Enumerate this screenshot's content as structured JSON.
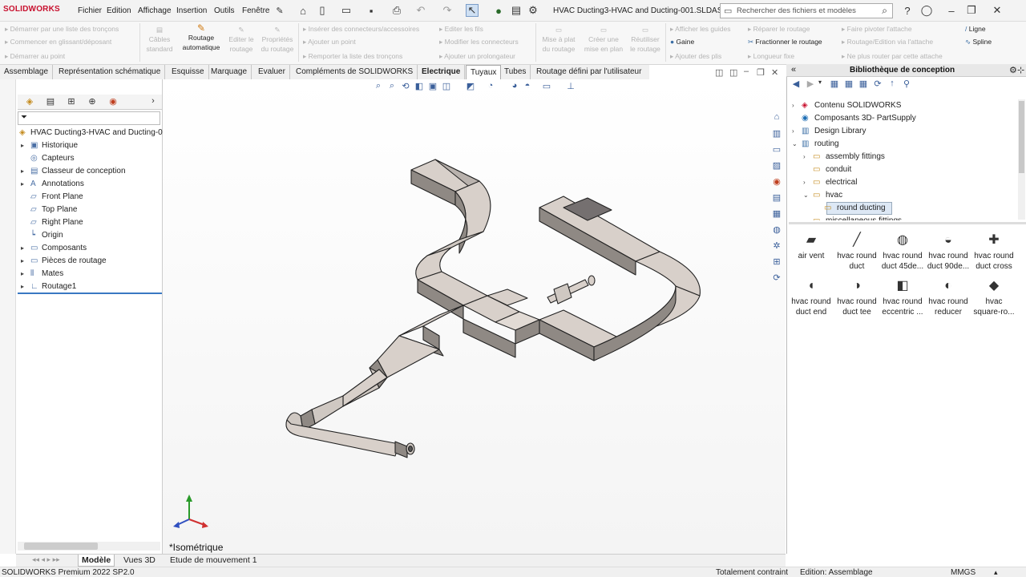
{
  "app": {
    "logo": "SOLIDWORKS",
    "document_title": "HVAC Ducting3-HVAC and Ducting-001.SLDAS...",
    "search_placeholder": "Rechercher des fichiers et modèles"
  },
  "menu": [
    "Fichier",
    "Edition",
    "Affichage",
    "Insertion",
    "Outils",
    "Fenêtre"
  ],
  "ribbon": {
    "col1": [
      "Démarrer par une liste des tronçons",
      "Commencer en glissant/déposant",
      "Démarrer au point"
    ],
    "btn_cables": [
      "Câbles",
      "standard"
    ],
    "btn_routage_auto": [
      "Routage",
      "automatique"
    ],
    "btn_editer_routage": [
      "Editer le",
      "routage"
    ],
    "btn_proprietes": [
      "Propriétés",
      "du routage"
    ],
    "col2": [
      "Insérer des connecteurs/accessoires",
      "Ajouter un point",
      "Remporter la liste des tronçons"
    ],
    "col3": [
      "Editer les fils",
      "Modifier les connecteurs",
      "Ajouter un prolongateur"
    ],
    "btn_mise_plat": [
      "Mise à plat",
      "du routage"
    ],
    "btn_creer_mise": [
      "Créer une",
      "mise en plan"
    ],
    "btn_reutiliser": [
      "Réutiliser",
      "le routage"
    ],
    "col4": [
      "Afficher les guides",
      "Gaine",
      "Ajouter des plis"
    ],
    "col5": [
      "Réparer le routage",
      "Fractionner le routage",
      "Longueur fixe"
    ],
    "col6": [
      "Faire pivoter l'attache",
      "Routage/Edition via l'attache",
      "Ne plus router par cette attache"
    ],
    "col7": [
      "Ligne",
      "Spline"
    ]
  },
  "tabs": [
    "Assemblage",
    "Représentation schématique",
    "Esquisse",
    "Marquage",
    "Evaluer",
    "Compléments de SOLIDWORKS",
    "Electrique",
    "Tuyaux",
    "Tubes",
    "Routage défini par l'utilisateur"
  ],
  "feature_tree": [
    {
      "label": "HVAC Ducting3-HVAC and Ducting-0",
      "arrow": "",
      "icon": "assembly-icon"
    },
    {
      "label": "Historique",
      "arrow": "▸",
      "icon": "history-icon"
    },
    {
      "label": "Capteurs",
      "arrow": "",
      "icon": "sensor-icon"
    },
    {
      "label": "Classeur de conception",
      "arrow": "▸",
      "icon": "binder-icon"
    },
    {
      "label": "Annotations",
      "arrow": "▸",
      "icon": "annotation-icon"
    },
    {
      "label": "Front Plane",
      "arrow": "",
      "icon": "plane-icon"
    },
    {
      "label": "Top Plane",
      "arrow": "",
      "icon": "plane-icon"
    },
    {
      "label": "Right Plane",
      "arrow": "",
      "icon": "plane-icon"
    },
    {
      "label": "Origin",
      "arrow": "",
      "icon": "origin-icon"
    },
    {
      "label": "Composants",
      "arrow": "▸",
      "icon": "folder-icon"
    },
    {
      "label": "Pièces de routage",
      "arrow": "▸",
      "icon": "folder-icon"
    },
    {
      "label": "Mates",
      "arrow": "▸",
      "icon": "mates-icon"
    },
    {
      "label": "Routage1",
      "arrow": "▸",
      "icon": "route-icon"
    }
  ],
  "viewport": {
    "view_label": "*Isométrique"
  },
  "design_library": {
    "title": "Bibliothèque de conception",
    "tree": [
      {
        "label": "Contenu SOLIDWORKS",
        "arrow": "›",
        "indent": 0
      },
      {
        "label": "Composants 3D- PartSupply",
        "arrow": "",
        "indent": 0
      },
      {
        "label": "Design Library",
        "arrow": "›",
        "indent": 0
      },
      {
        "label": "routing",
        "arrow": "⌄",
        "indent": 0
      },
      {
        "label": "assembly fittings",
        "arrow": "›",
        "indent": 1
      },
      {
        "label": "conduit",
        "arrow": "",
        "indent": 1
      },
      {
        "label": "electrical",
        "arrow": "›",
        "indent": 1
      },
      {
        "label": "hvac",
        "arrow": "⌄",
        "indent": 1
      },
      {
        "label": "round ducting",
        "arrow": "",
        "indent": 2
      },
      {
        "label": "miscellaneous fittings",
        "arrow": "",
        "indent": 1
      }
    ],
    "parts": [
      [
        "air vent"
      ],
      [
        "hvac round",
        "duct"
      ],
      [
        "hvac round",
        "duct 45de..."
      ],
      [
        "hvac round",
        "duct 90de..."
      ],
      [
        "hvac round",
        "duct cross"
      ],
      [
        "hvac round",
        "duct end"
      ],
      [
        "hvac round",
        "duct tee"
      ],
      [
        "hvac round",
        "eccentric ..."
      ],
      [
        "hvac round",
        "reducer"
      ],
      [
        "hvac",
        "square-ro..."
      ]
    ]
  },
  "bottom_tabs": [
    "Modèle",
    "Vues 3D",
    "Etude de mouvement 1"
  ],
  "status": {
    "product": "SOLIDWORKS Premium 2022 SP2.0",
    "constraint": "Totalement contraint",
    "mode": "Edition: Assemblage",
    "units": "MMGS"
  }
}
